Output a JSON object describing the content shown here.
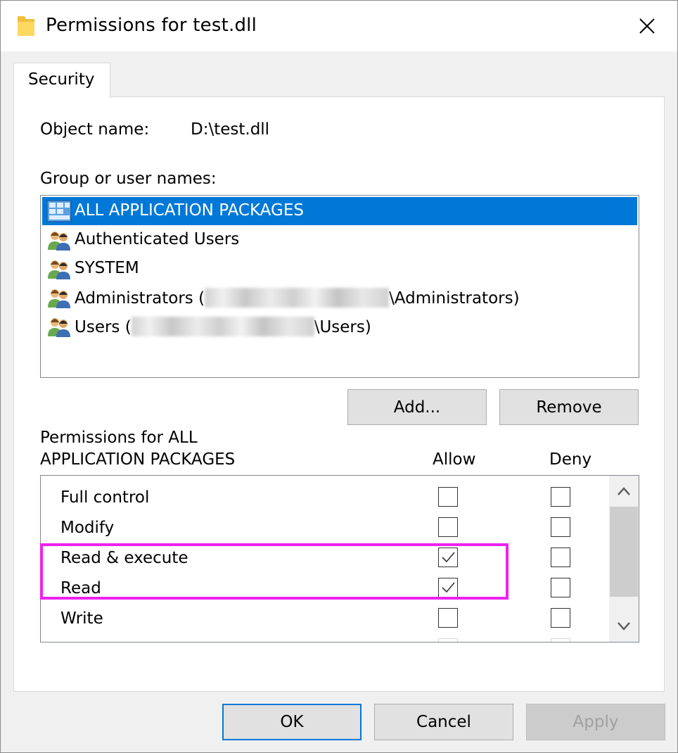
{
  "window": {
    "title": "Permissions for test.dll",
    "close_icon": "close-icon",
    "title_icon": "folder-icon"
  },
  "tabs": [
    {
      "label": "Security",
      "active": true
    }
  ],
  "object": {
    "label": "Object name:",
    "value": "D:\\test.dll"
  },
  "groups": {
    "label": "Group or user names:",
    "items": [
      {
        "name": "ALL APPLICATION PACKAGES",
        "icon": "app-packages-icon",
        "selected": true
      },
      {
        "name": "Authenticated Users",
        "icon": "users-group-icon",
        "selected": false
      },
      {
        "name": "SYSTEM",
        "icon": "users-group-icon",
        "selected": false
      },
      {
        "name_prefix": "Administrators (",
        "name_suffix": "\\Administrators)",
        "icon": "users-group-icon",
        "selected": false,
        "redacted": true
      },
      {
        "name_prefix": "Users (",
        "name_suffix": "\\Users)",
        "icon": "users-group-icon",
        "selected": false,
        "redacted": true
      }
    ],
    "add_button": "Add...",
    "remove_button": "Remove"
  },
  "permissions": {
    "label_line1": "Permissions for ALL",
    "label_line2": "APPLICATION PACKAGES",
    "allow_header": "Allow",
    "deny_header": "Deny",
    "rows": [
      {
        "name": "Full control",
        "allow": false,
        "deny": false
      },
      {
        "name": "Modify",
        "allow": false,
        "deny": false
      },
      {
        "name": "Read & execute",
        "allow": true,
        "deny": false
      },
      {
        "name": "Read",
        "allow": true,
        "deny": false
      },
      {
        "name": "Write",
        "allow": false,
        "deny": false
      }
    ]
  },
  "footer": {
    "ok": "OK",
    "cancel": "Cancel",
    "apply": "Apply"
  },
  "colors": {
    "selection": "#0078d7",
    "highlight_box": "#ee22ee"
  }
}
